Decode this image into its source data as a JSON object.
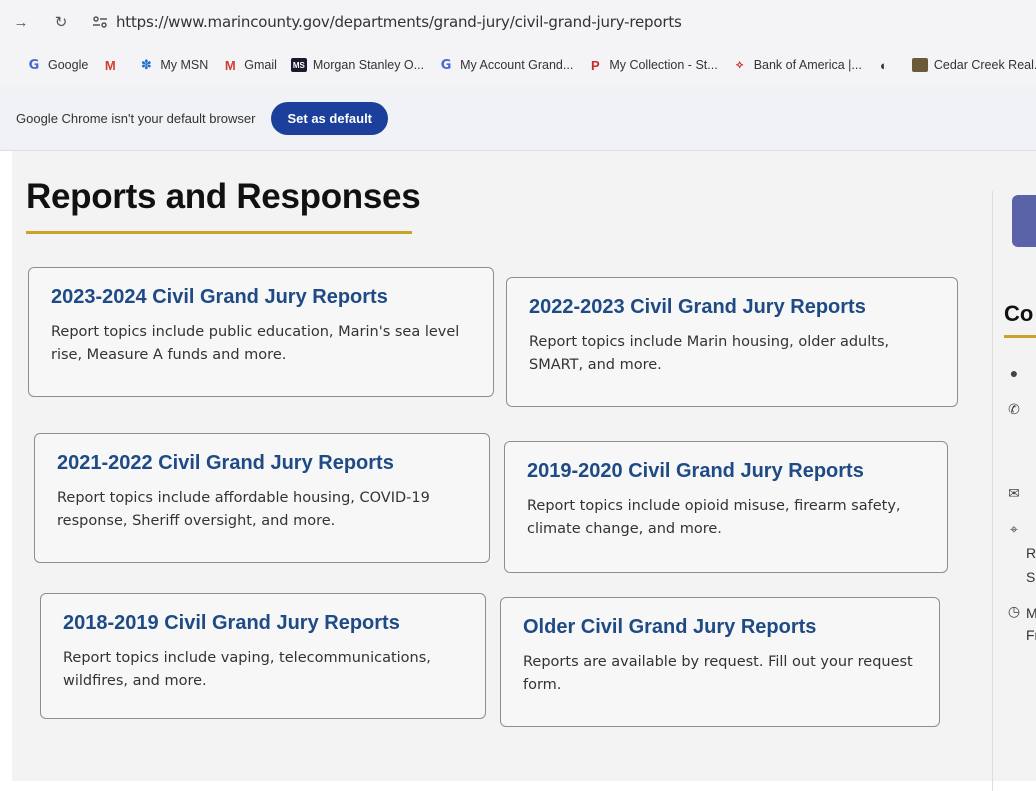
{
  "browser": {
    "url": "https://www.marincounty.gov/departments/grand-jury/civil-grand-jury-reports",
    "bookmarks": [
      {
        "label": "Google",
        "icon": "G"
      },
      {
        "label": "",
        "icon": "M"
      },
      {
        "label": "My MSN",
        "icon": "msn"
      },
      {
        "label": "Gmail",
        "icon": "M"
      },
      {
        "label": "Morgan Stanley O...",
        "icon": "MS"
      },
      {
        "label": "My Account Grand...",
        "icon": "G"
      },
      {
        "label": "My Collection - St...",
        "icon": "P"
      },
      {
        "label": "Bank of America |...",
        "icon": "boa"
      },
      {
        "label": "",
        "icon": "globe"
      },
      {
        "label": "Cedar Creek Real...",
        "icon": "cc"
      }
    ],
    "infobar_text": "Google Chrome isn't your default browser",
    "set_default_label": "Set as default"
  },
  "page": {
    "title": "Reports and Responses",
    "cards": [
      {
        "title": "2023-2024 Civil Grand Jury Reports",
        "desc": "Report topics include public education, Marin's sea level rise, Measure A funds and more."
      },
      {
        "title": "2022-2023 Civil Grand Jury Reports",
        "desc": "Report topics include Marin housing, older adults, SMART, and more."
      },
      {
        "title": "2021-2022 Civil Grand Jury Reports",
        "desc": "Report topics include affordable housing, COVID-19 response, Sheriff oversight, and more."
      },
      {
        "title": "2019-2020 Civil Grand Jury Reports",
        "desc": "Report topics include opioid misuse, firearm safety, climate change, and more."
      },
      {
        "title": "2018-2019 Civil Grand Jury Reports",
        "desc": "Report topics include vaping, telecommunications, wildfires, and more."
      },
      {
        "title": "Older Civil Grand Jury Reports",
        "desc": "Reports are available by request. Fill out your request form."
      }
    ]
  },
  "sidebar": {
    "heading": "Co",
    "address_line2": "R",
    "address_line3": "S",
    "hours_line1": "M",
    "hours_line2": "Fr"
  },
  "colors": {
    "card_title": "#1e4a85",
    "accent_underline": "#c9a227",
    "button": "#1b3f9b"
  }
}
